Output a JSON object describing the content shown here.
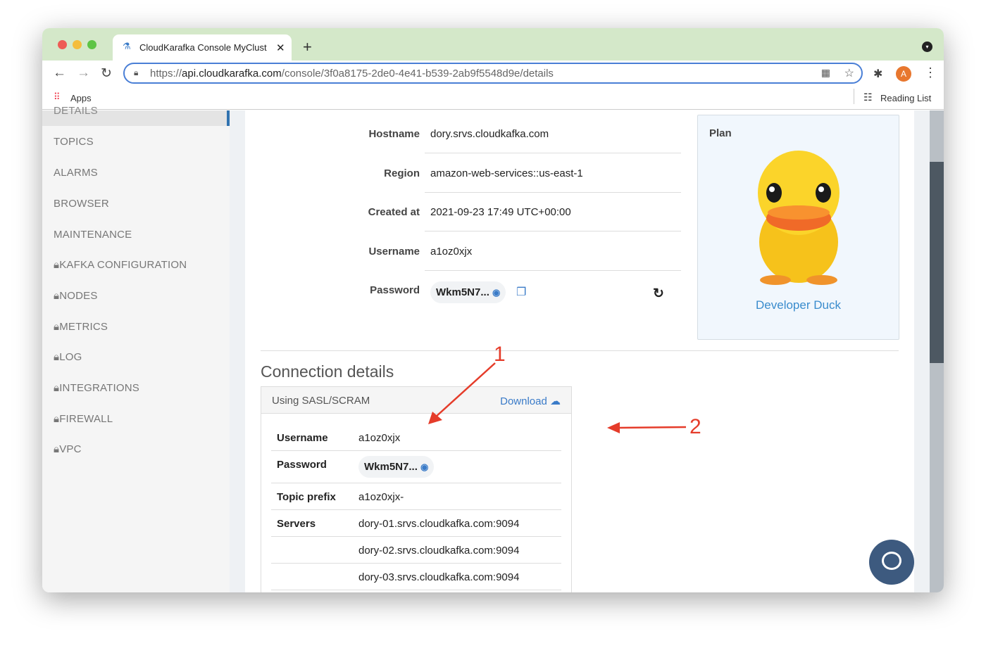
{
  "browser": {
    "tab_title": "CloudKarafka Console MyClust",
    "url_prefix": "https://",
    "url_host": "api.cloudkarafka.com",
    "url_path": "/console/3f0a8175-2de0-4e41-b539-2ab9f5548d9e/details",
    "apps_label": "Apps",
    "reading_list": "Reading List",
    "profile_initial": "A"
  },
  "sidebar": {
    "items": [
      "DETAILS",
      "TOPICS",
      "ALARMS",
      "BROWSER",
      "MAINTENANCE",
      "KAFKA CONFIGURATION",
      "NODES",
      "METRICS",
      "LOG",
      "INTEGRATIONS",
      "FIREWALL",
      "VPC"
    ]
  },
  "details": {
    "hostname_label": "Hostname",
    "hostname": "dory.srvs.cloudkafka.com",
    "region_label": "Region",
    "region": "amazon-web-services::us-east-1",
    "created_label": "Created at",
    "created": "2021-09-23 17:49 UTC+00:00",
    "username_label": "Username",
    "username": "a1oz0xjx",
    "password_label": "Password",
    "password": "Wkm5N7..."
  },
  "plan": {
    "label": "Plan",
    "name": "Developer Duck"
  },
  "connection": {
    "title": "Connection details",
    "method": "Using SASL/SCRAM",
    "download": "Download",
    "username_label": "Username",
    "username": "a1oz0xjx",
    "password_label": "Password",
    "password": "Wkm5N7...",
    "topic_prefix_label": "Topic prefix",
    "topic_prefix": "a1oz0xjx-",
    "servers_label": "Servers",
    "servers": [
      "dory-01.srvs.cloudkafka.com:9094",
      "dory-02.srvs.cloudkafka.com:9094",
      "dory-03.srvs.cloudkafka.com:9094"
    ]
  },
  "annotations": [
    "1",
    "2"
  ],
  "colors": {
    "accent": "#3a7bc8",
    "annotation": "#e53c2a",
    "tabbar": "#d4e8c9"
  }
}
